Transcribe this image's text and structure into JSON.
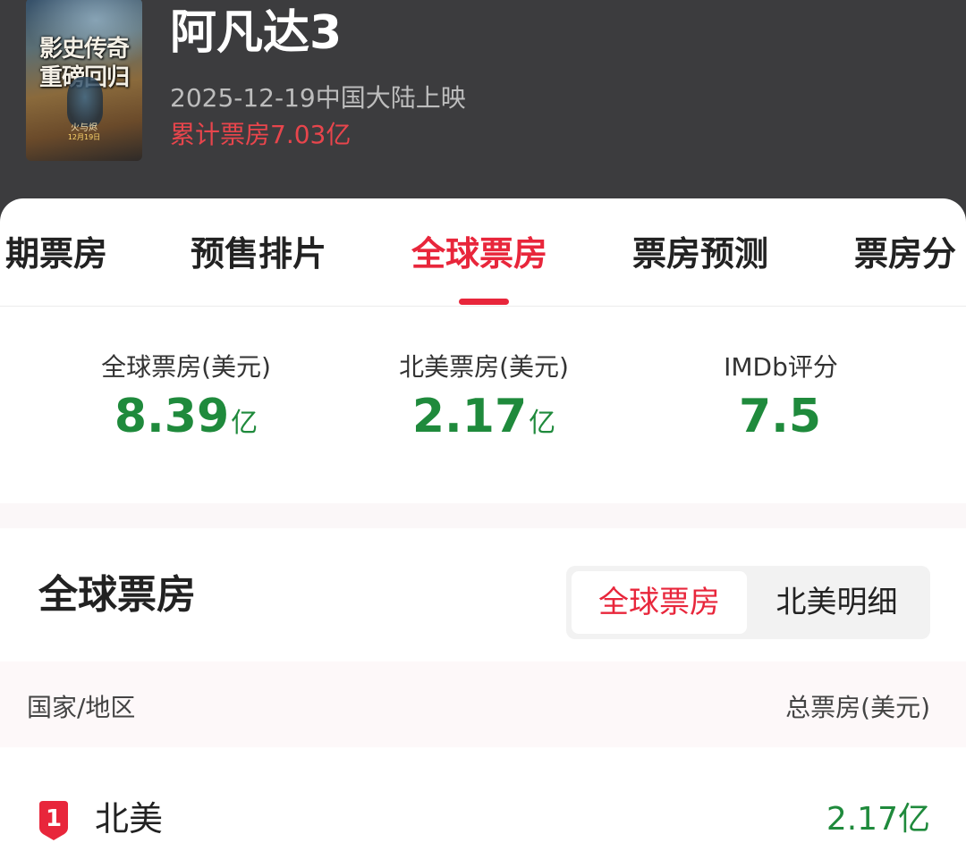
{
  "movie": {
    "title": "阿凡达3",
    "release": "2025-12-19中国大陆上映",
    "cumulative_box_office": "累计票房7.03亿",
    "poster": {
      "line1": "影史传奇",
      "line2": "重磅回归",
      "subtitle": "火与烬",
      "date": "12月19日"
    }
  },
  "tabs": [
    {
      "label": "期票房",
      "active": false
    },
    {
      "label": "预售排片",
      "active": false
    },
    {
      "label": "全球票房",
      "active": true
    },
    {
      "label": "票房预测",
      "active": false
    },
    {
      "label": "票房分",
      "active": false
    }
  ],
  "stats": [
    {
      "label": "全球票房(美元)",
      "value": "8.39",
      "unit": "亿"
    },
    {
      "label": "北美票房(美元)",
      "value": "2.17",
      "unit": "亿"
    },
    {
      "label": "IMDb评分",
      "value": "7.5",
      "unit": ""
    }
  ],
  "section": {
    "title": "全球票房",
    "toggle": [
      {
        "label": "全球票房",
        "active": true
      },
      {
        "label": "北美明细",
        "active": false
      }
    ]
  },
  "table": {
    "headers": {
      "region": "国家/地区",
      "total": "总票房(美元)"
    },
    "rows": [
      {
        "rank": "1",
        "region": "北美",
        "amount": "2.17亿"
      }
    ]
  },
  "colors": {
    "accent": "#e8263b",
    "positive": "#1f8a3c",
    "header_bg": "#3c3c3e"
  }
}
